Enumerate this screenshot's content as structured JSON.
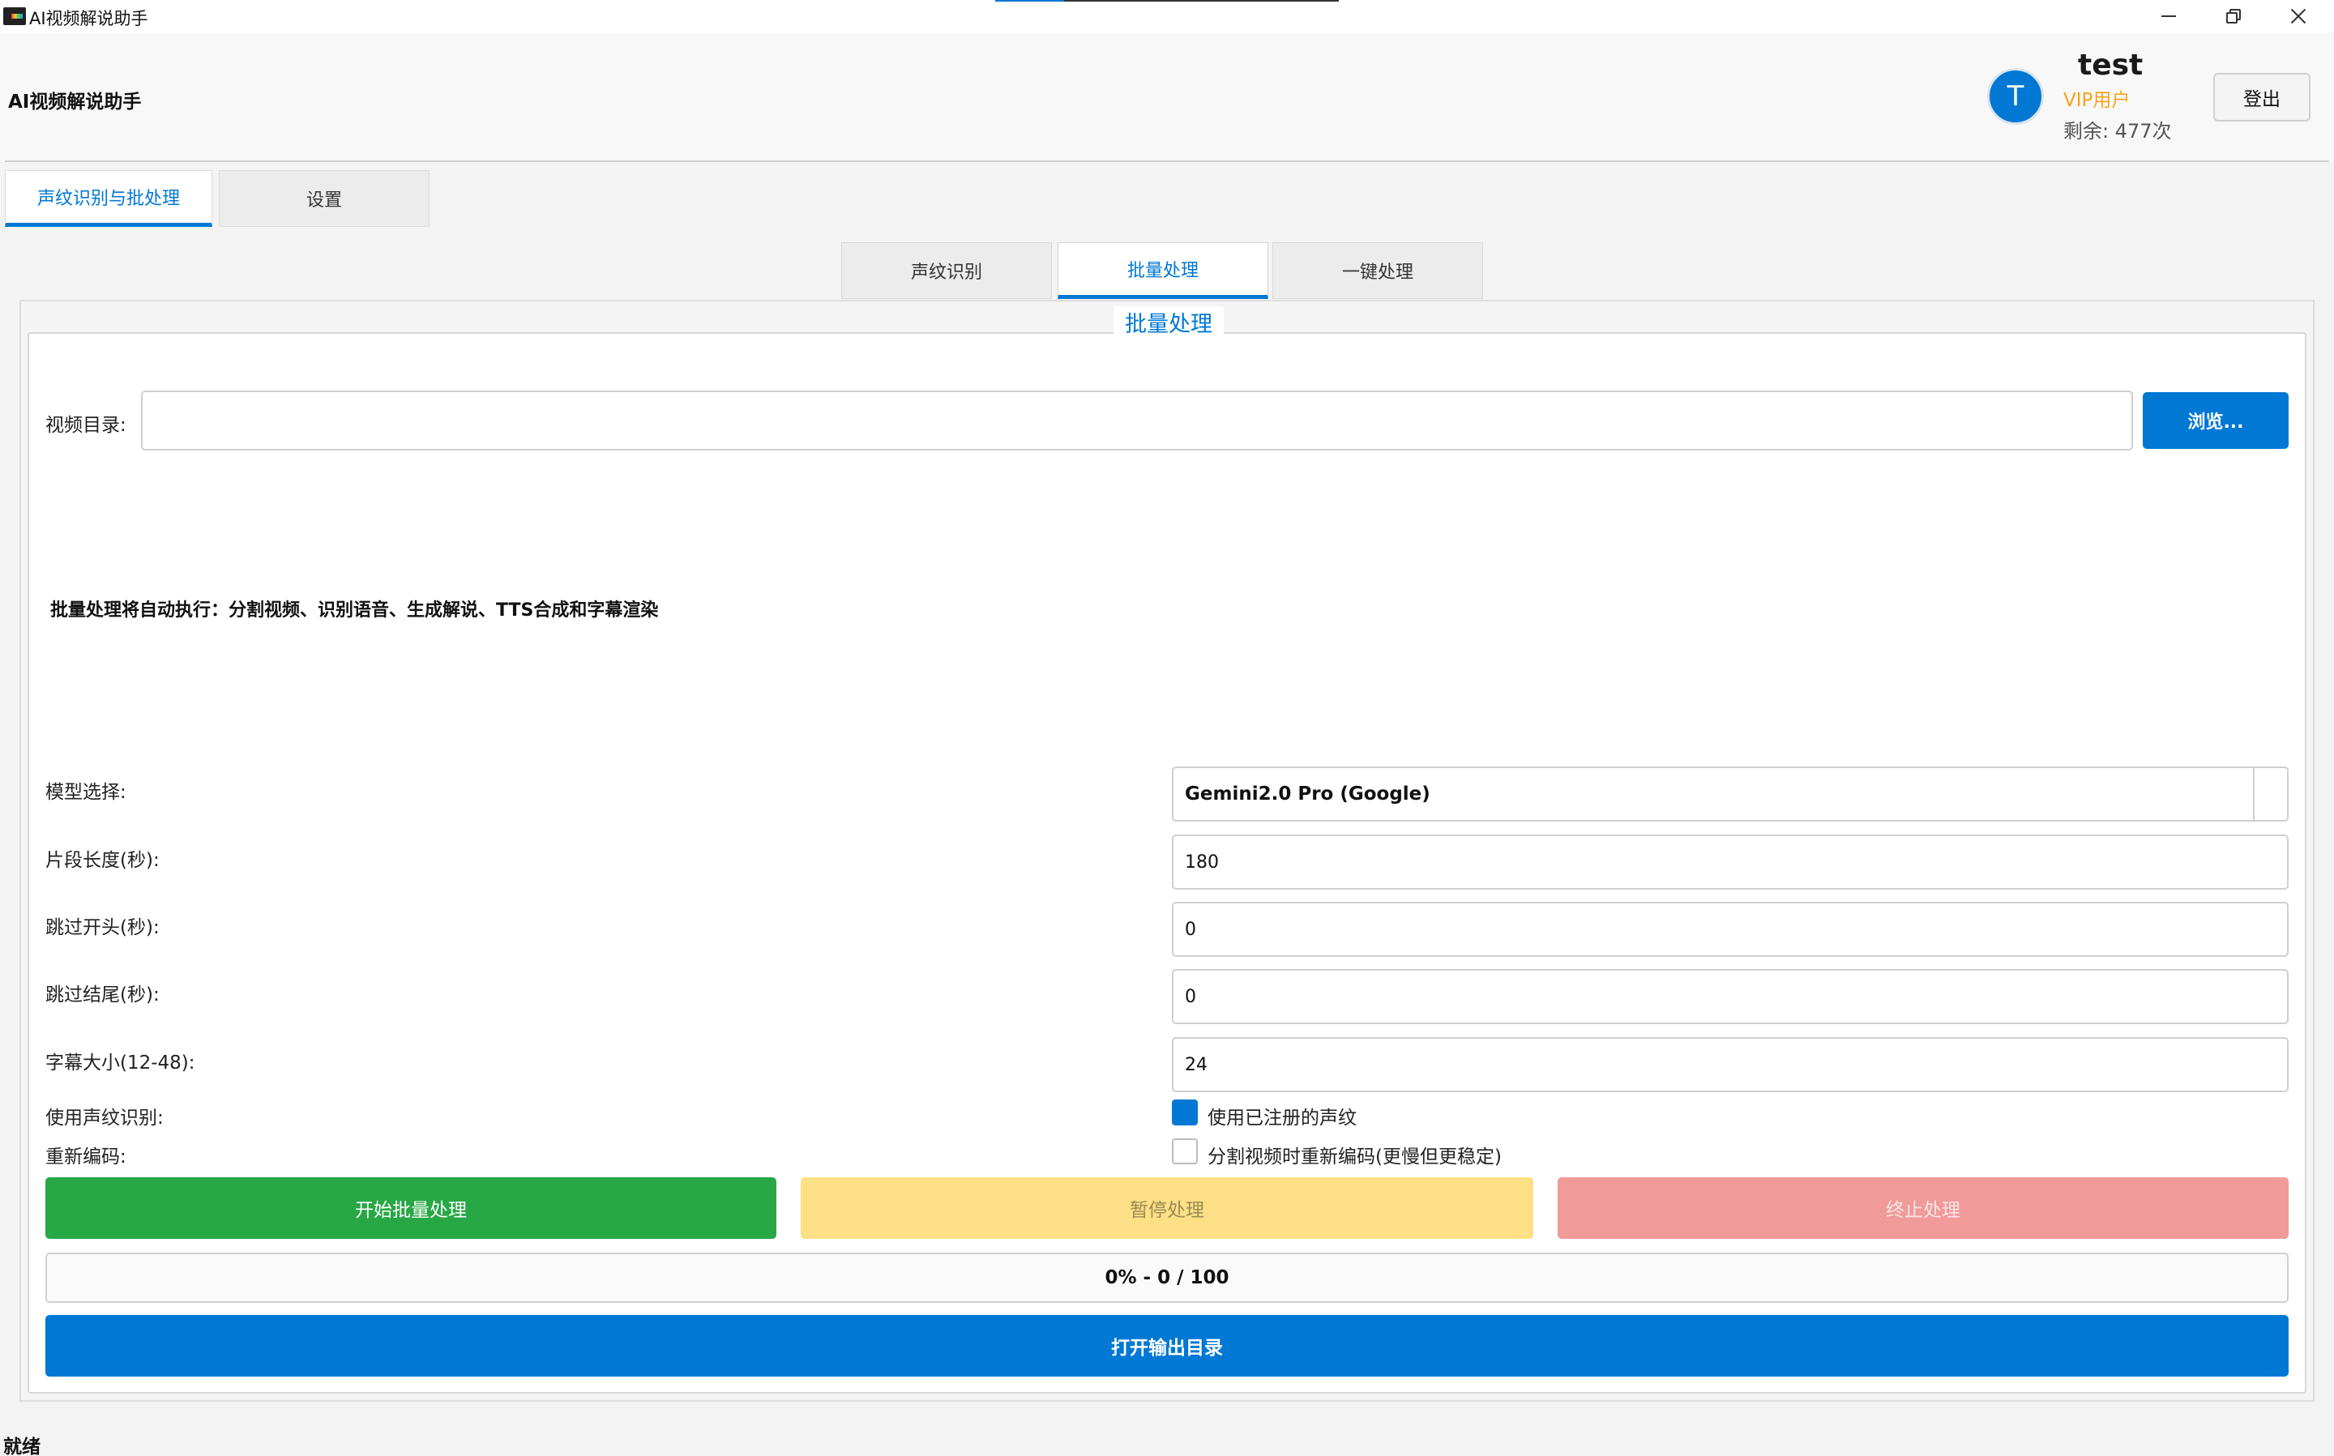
{
  "window": {
    "title": "AI视频解说助手",
    "title_progress_fraction": 0.2,
    "controls": [
      "minimize-icon",
      "restore-icon",
      "close-icon"
    ]
  },
  "header": {
    "app_name": "AI视频解说助手",
    "user": {
      "avatar_letter": "T",
      "username": "test",
      "role": "VIP用户",
      "remaining": "剩余: 477次"
    },
    "logout_label": "登出"
  },
  "main_tabs": [
    {
      "label": "声纹识别与批处理",
      "active": true
    },
    {
      "label": "设置",
      "active": false
    }
  ],
  "sub_tabs": [
    {
      "label": "声纹识别",
      "active": false
    },
    {
      "label": "批量处理",
      "active": true
    },
    {
      "label": "一键处理",
      "active": false
    }
  ],
  "panel": {
    "title": "批量处理",
    "video_dir": {
      "label": "视频目录:",
      "value": "",
      "placeholder": ""
    },
    "browse_label": "浏览...",
    "info_text": "批量处理将自动执行：分割视频、识别语音、生成解说、TTS合成和字幕渲染",
    "model": {
      "label": "模型选择:",
      "value": "Gemini2.0 Pro (Google)"
    },
    "segment_length": {
      "label": "片段长度(秒):",
      "value": "180"
    },
    "skip_start": {
      "label": "跳过开头(秒):",
      "value": "0"
    },
    "skip_end": {
      "label": "跳过结尾(秒):",
      "value": "0"
    },
    "font_size": {
      "label": "字幕大小(12-48):",
      "value": "24"
    },
    "use_voiceprint": {
      "label": "使用声纹识别:",
      "checkbox_label": "使用已注册的声纹",
      "checked": true
    },
    "reencode": {
      "label": "重新编码:",
      "checkbox_label": "分割视频时重新编码(更慢但更稳定)",
      "checked": false
    },
    "start_label": "开始批量处理",
    "pause_label": "暂停处理",
    "stop_label": "终止处理",
    "progress": {
      "text": "0% - 0 / 100",
      "percent": 0
    },
    "open_output_label": "打开输出目录"
  },
  "colors": {
    "accent": "#0078d4",
    "start": "#28a745",
    "pause": "#fde085",
    "stop": "#f09a9a",
    "vip": "#f7a21b"
  },
  "status_bar": {
    "text": "就绪"
  }
}
